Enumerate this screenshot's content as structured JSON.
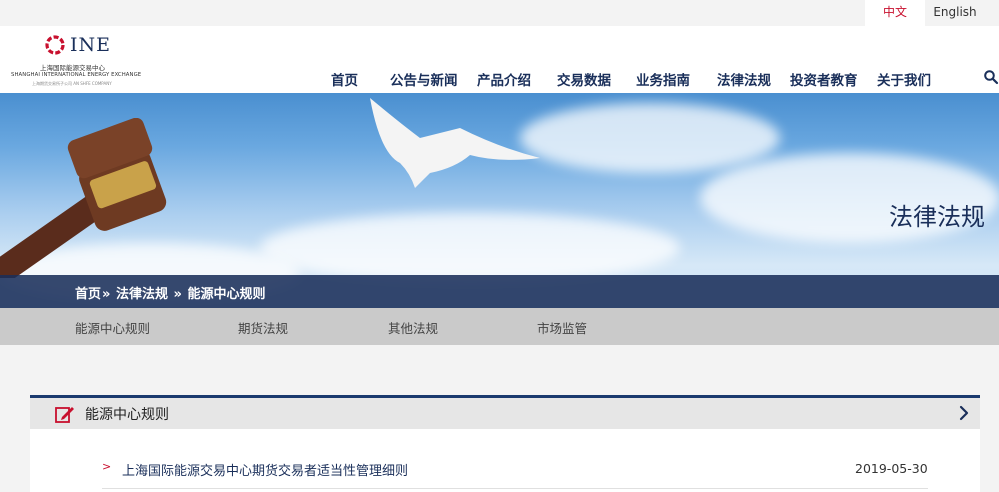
{
  "lang": {
    "zh": "中文",
    "en": "English"
  },
  "logo": {
    "short": "INE",
    "name_cn": "上海国际能源交易中心",
    "name_en": "SHANGHAI INTERNATIONAL ENERGY EXCHANGE",
    "sub": "上海期货交易所子公司  AN SHFE COMPANY"
  },
  "nav": [
    "首页",
    "公告与新闻",
    "产品介绍",
    "交易数据",
    "业务指南",
    "法律法规",
    "投资者教育",
    "关于我们"
  ],
  "banner": {
    "title": "法律法规"
  },
  "breadcrumb": {
    "home": "首页",
    "sep1": "»",
    "section": "法律法规",
    "sep2": "»",
    "current": "能源中心规则"
  },
  "subnav": [
    "能源中心规则",
    "期货法规",
    "其他法规",
    "市场监管"
  ],
  "panel": {
    "title": "能源中心规则",
    "items": [
      {
        "arrow": ">",
        "title": "上海国际能源交易中心期货交易者适当性管理细则",
        "date": "2019-05-30"
      }
    ]
  },
  "colors": {
    "brand_navy": "#1a2f5a",
    "accent_red": "#c8102e"
  }
}
